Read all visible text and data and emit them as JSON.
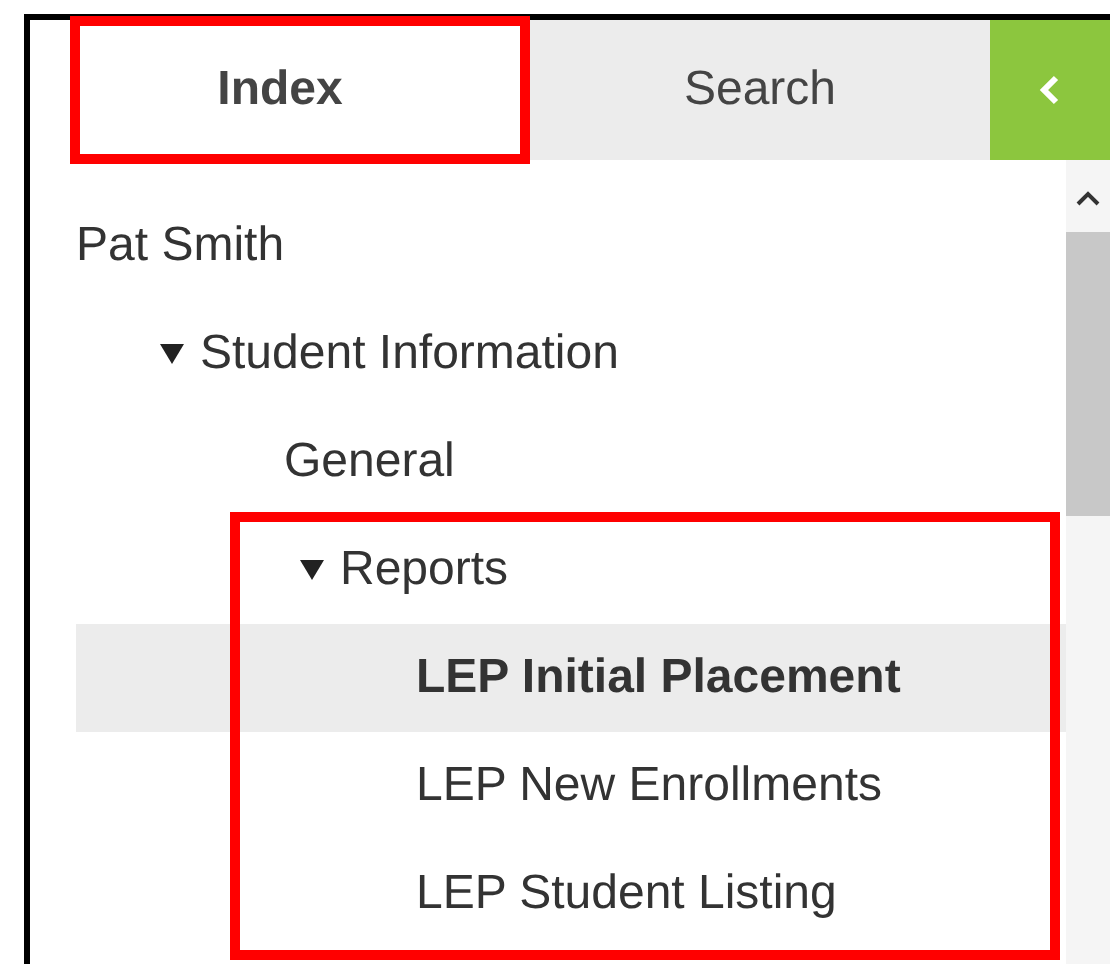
{
  "tabs": [
    {
      "label": "Index",
      "selected": true,
      "annotated": true
    },
    {
      "label": "Search",
      "selected": false,
      "annotated": false
    }
  ],
  "tree": [
    {
      "label": "Pat Smith",
      "selected": false,
      "children": [
        {
          "label": "Student Information",
          "expanded": true,
          "selected": false,
          "children": [
            {
              "label": "General",
              "selected": false
            },
            {
              "label": "Reports",
              "expanded": true,
              "selected": false,
              "annotated": true,
              "children": [
                {
                  "label": "LEP Initial Placement",
                  "selected": true
                },
                {
                  "label": "LEP New Enrollments",
                  "selected": false
                },
                {
                  "label": "LEP Student Listing",
                  "selected": false
                }
              ]
            }
          ]
        }
      ]
    }
  ]
}
